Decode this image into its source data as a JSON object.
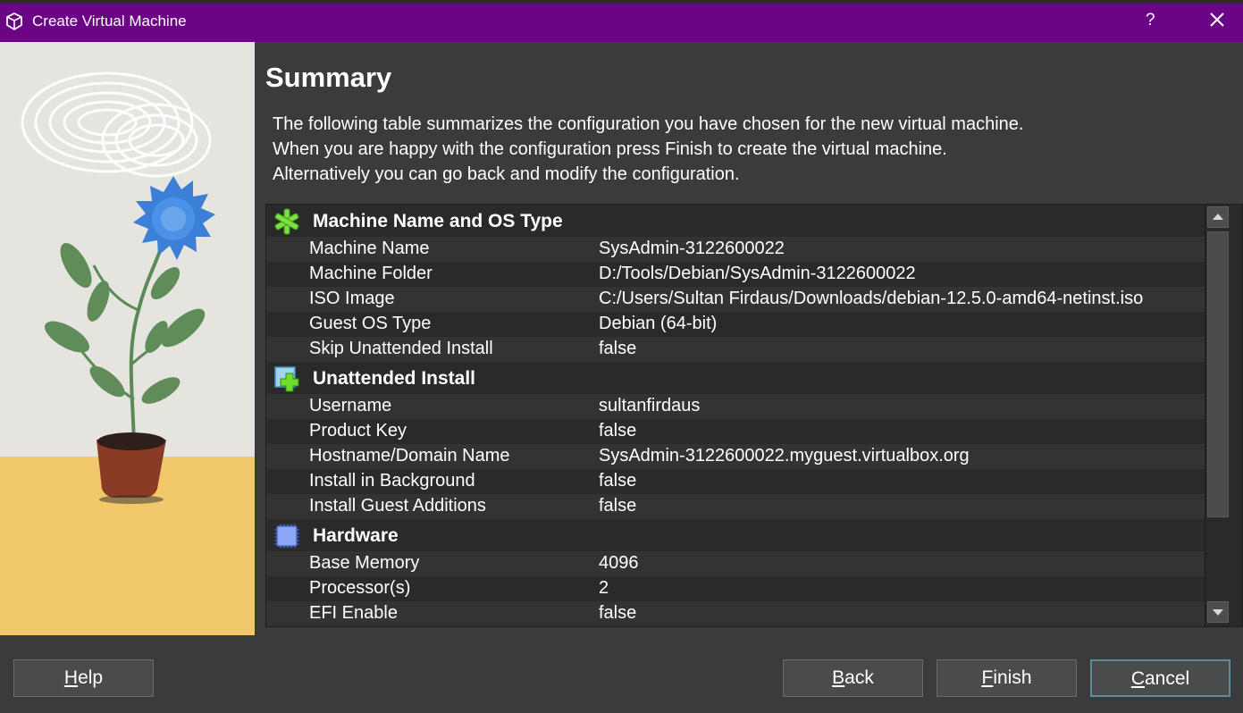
{
  "window": {
    "title": "Create Virtual Machine",
    "help_label": "?"
  },
  "page": {
    "heading": "Summary",
    "description": [
      "The following table summarizes the configuration you have chosen for the new virtual machine.",
      "When you are happy with the configuration press Finish to create the virtual machine.",
      "Alternatively you can go back and modify the configuration."
    ]
  },
  "summary": {
    "sections": [
      {
        "title": "Machine Name and OS Type",
        "icon": "green-asterisk-icon",
        "rows": [
          {
            "key": "Machine Name",
            "value": "SysAdmin-3122600022"
          },
          {
            "key": "Machine Folder",
            "value": "D:/Tools/Debian/SysAdmin-3122600022"
          },
          {
            "key": "ISO Image",
            "value": "C:/Users/Sultan Firdaus/Downloads/debian-12.5.0-amd64-netinst.iso"
          },
          {
            "key": "Guest OS Type",
            "value": "Debian (64-bit)"
          },
          {
            "key": "Skip Unattended Install",
            "value": "false"
          }
        ]
      },
      {
        "title": "Unattended Install",
        "icon": "install-plus-icon",
        "rows": [
          {
            "key": "Username",
            "value": "sultanfirdaus"
          },
          {
            "key": "Product Key",
            "value": "false"
          },
          {
            "key": "Hostname/Domain Name",
            "value": "SysAdmin-3122600022.myguest.virtualbox.org"
          },
          {
            "key": "Install in Background",
            "value": "false"
          },
          {
            "key": "Install Guest Additions",
            "value": "false"
          }
        ]
      },
      {
        "title": "Hardware",
        "icon": "chip-icon",
        "rows": [
          {
            "key": "Base Memory",
            "value": "4096"
          },
          {
            "key": "Processor(s)",
            "value": "2"
          },
          {
            "key": "EFI Enable",
            "value": "false"
          }
        ]
      }
    ]
  },
  "buttons": {
    "help": {
      "mnemonic": "H",
      "rest": "elp"
    },
    "back": {
      "mnemonic": "B",
      "rest": "ack"
    },
    "finish": {
      "mnemonic": "F",
      "rest": "inish"
    },
    "cancel": {
      "mnemonic": "C",
      "rest": "ancel"
    }
  },
  "colors": {
    "titlebar": "#6c0486",
    "dialog_bg": "#3a3b3d",
    "table_bg": "#2a2a2a",
    "row_alt": "#333334",
    "accent_border": "#5c8ea0"
  }
}
